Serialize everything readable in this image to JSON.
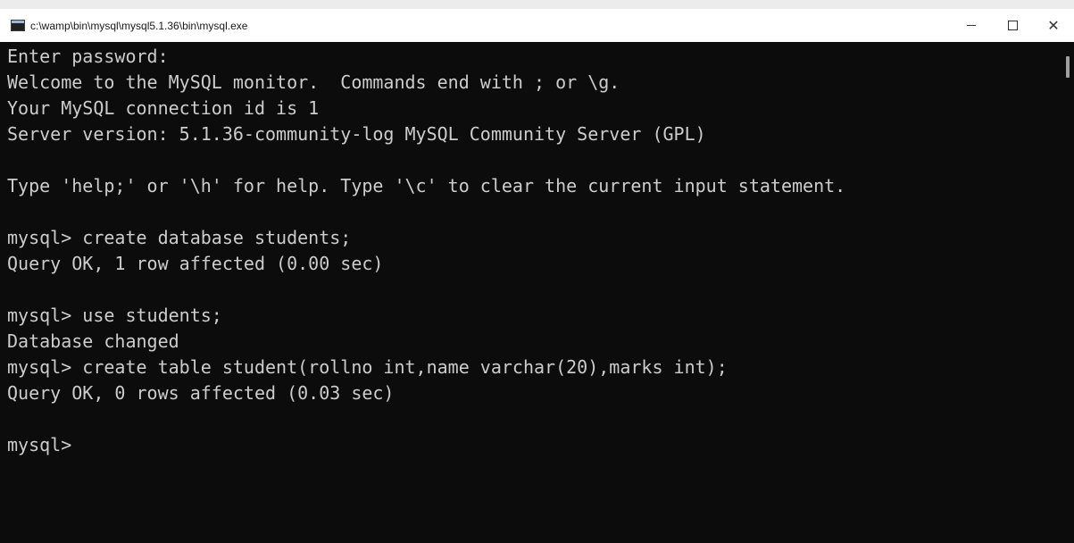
{
  "window": {
    "title": "c:\\wamp\\bin\\mysql\\mysql5.1.36\\bin\\mysql.exe",
    "controls": {
      "minimize": "–",
      "maximize": "□",
      "close": "✕"
    }
  },
  "console": {
    "lines": [
      "Enter password:",
      "Welcome to the MySQL monitor.  Commands end with ; or \\g.",
      "Your MySQL connection id is 1",
      "Server version: 5.1.36-community-log MySQL Community Server (GPL)",
      "",
      "Type 'help;' or '\\h' for help. Type '\\c' to clear the current input statement.",
      "",
      "mysql> create database students;",
      "Query OK, 1 row affected (0.00 sec)",
      "",
      "mysql> use students;",
      "Database changed",
      "mysql> create table student(rollno int,name varchar(20),marks int);",
      "Query OK, 0 rows affected (0.03 sec)",
      "",
      "mysql>"
    ]
  },
  "colors": {
    "console_bg": "#0c0c0c",
    "console_fg": "#cccccc",
    "titlebar_bg": "#ffffff"
  }
}
